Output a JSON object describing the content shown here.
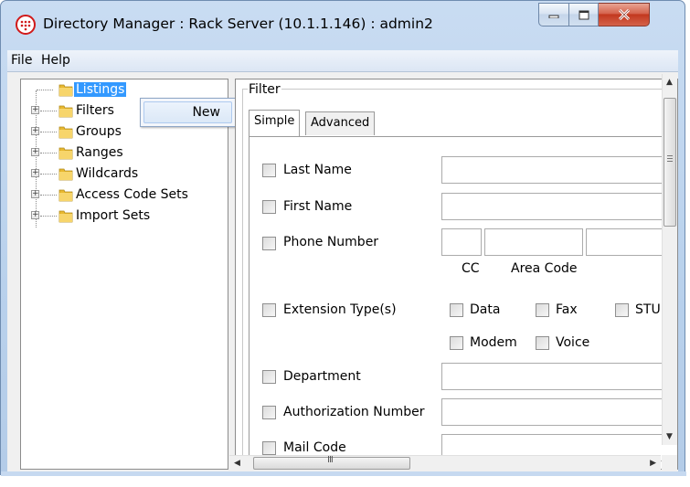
{
  "window": {
    "title": "Directory Manager : Rack Server (10.1.1.146) : admin2"
  },
  "menu": [
    "File",
    "Help"
  ],
  "tree": {
    "items": [
      {
        "label": "Listings",
        "selected": true,
        "expandable": false
      },
      {
        "label": "Filters",
        "expandable": true
      },
      {
        "label": "Groups",
        "expandable": true
      },
      {
        "label": "Ranges",
        "expandable": true
      },
      {
        "label": "Wildcards",
        "expandable": true
      },
      {
        "label": "Access Code Sets",
        "expandable": true
      },
      {
        "label": "Import Sets",
        "expandable": true
      }
    ]
  },
  "context_menu": {
    "new_label": "New"
  },
  "filter": {
    "legend": "Filter",
    "tabs": [
      "Simple",
      "Advanced"
    ],
    "active_tab": "Simple",
    "fields": {
      "last_name": "Last Name",
      "first_name": "First Name",
      "phone_number": "Phone Number",
      "extension_types": "Extension Type(s)",
      "department": "Department",
      "authorization_number": "Authorization Number",
      "mail_code": "Mail Code"
    },
    "phone_sublabels": {
      "cc": "CC",
      "area_code": "Area Code"
    },
    "extension_options": [
      "Data",
      "Fax",
      "STU",
      "Modem",
      "Voice"
    ]
  },
  "scrollbar": {
    "h_thumb_glyph": "III"
  },
  "colors": {
    "selection": "#3399ff",
    "close_button": "#c2381f",
    "title_bar": "#c9dcf2"
  }
}
